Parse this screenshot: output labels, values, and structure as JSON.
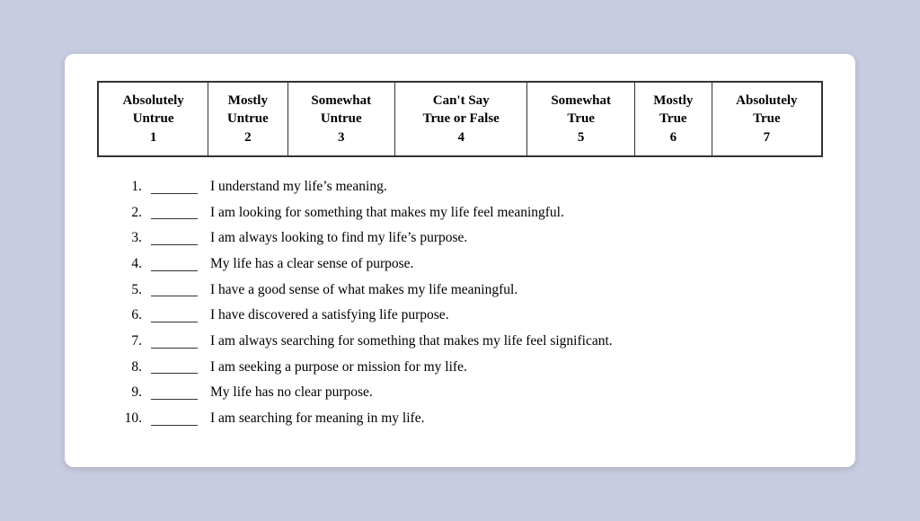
{
  "scale": {
    "columns": [
      {
        "label": "Absolutely\nUntrue",
        "number": "1"
      },
      {
        "label": "Mostly\nUntrue",
        "number": "2"
      },
      {
        "label": "Somewhat\nUntrue",
        "number": "3"
      },
      {
        "label": "Can't Say\nTrue or False",
        "number": "4"
      },
      {
        "label": "Somewhat\nTrue",
        "number": "5"
      },
      {
        "label": "Mostly\nTrue",
        "number": "6"
      },
      {
        "label": "Absolutely\nTrue",
        "number": "7"
      }
    ]
  },
  "items": [
    {
      "number": "1.",
      "text": "I understand my life’s meaning."
    },
    {
      "number": "2.",
      "text": "I am looking for something that makes my life feel meaningful."
    },
    {
      "number": "3.",
      "text": "I am always looking to find my life’s purpose."
    },
    {
      "number": "4.",
      "text": "My life has a clear sense of purpose."
    },
    {
      "number": "5.",
      "text": "I have a good sense of what makes my life meaningful."
    },
    {
      "number": "6.",
      "text": "I have discovered a satisfying life purpose."
    },
    {
      "number": "7.",
      "text": "I am always searching for something that makes my life feel significant."
    },
    {
      "number": "8.",
      "text": "I am seeking a purpose or mission for my life."
    },
    {
      "number": "9.",
      "text": "My life has no clear purpose."
    },
    {
      "number": "10.",
      "text": "I am searching for meaning in my life."
    }
  ]
}
